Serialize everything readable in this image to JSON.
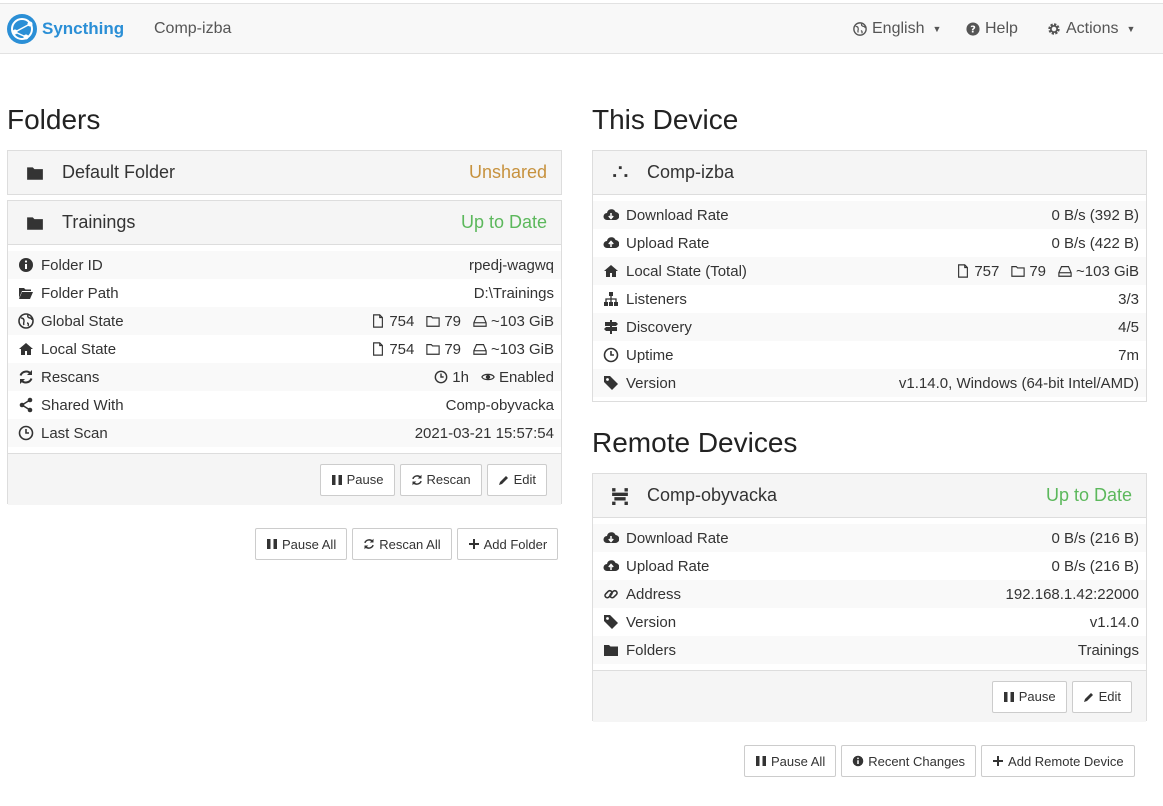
{
  "navbar": {
    "brand": "Syncthing",
    "device_name": "Comp-izba",
    "language": "English",
    "help": "Help",
    "actions": "Actions"
  },
  "folders": {
    "heading": "Folders",
    "default_folder": {
      "name": "Default Folder",
      "status": "Unshared"
    },
    "trainings": {
      "name": "Trainings",
      "status": "Up to Date",
      "rows": [
        {
          "label": "Folder ID",
          "value": "rpedj-wagwq"
        },
        {
          "label": "Folder Path",
          "value": "D:\\Trainings"
        },
        {
          "label": "Global State",
          "files": "754",
          "dirs": "79",
          "size": "~103 GiB"
        },
        {
          "label": "Local State",
          "files": "754",
          "dirs": "79",
          "size": "~103 GiB"
        },
        {
          "label": "Rescans",
          "interval": "1h",
          "watch": "Enabled"
        },
        {
          "label": "Shared With",
          "value": "Comp-obyvacka"
        },
        {
          "label": "Last Scan",
          "value": "2021-03-21 15:57:54"
        }
      ],
      "buttons": {
        "pause": "Pause",
        "rescan": "Rescan",
        "edit": "Edit"
      }
    },
    "buttons": {
      "pause_all": "Pause All",
      "rescan_all": "Rescan All",
      "add_folder": "Add Folder"
    }
  },
  "this_device": {
    "heading": "This Device",
    "name": "Comp-izba",
    "rows": [
      {
        "label": "Download Rate",
        "value": "0 B/s (392 B)"
      },
      {
        "label": "Upload Rate",
        "value": "0 B/s (422 B)"
      },
      {
        "label": "Local State (Total)",
        "files": "757",
        "dirs": "79",
        "size": "~103 GiB"
      },
      {
        "label": "Listeners",
        "value": "3/3"
      },
      {
        "label": "Discovery",
        "value": "4/5"
      },
      {
        "label": "Uptime",
        "value": "7m"
      },
      {
        "label": "Version",
        "value": "v1.14.0, Windows (64-bit Intel/AMD)"
      }
    ]
  },
  "remote_devices": {
    "heading": "Remote Devices",
    "device": {
      "name": "Comp-obyvacka",
      "status": "Up to Date",
      "rows": [
        {
          "label": "Download Rate",
          "value": "0 B/s (216 B)"
        },
        {
          "label": "Upload Rate",
          "value": "0 B/s (216 B)"
        },
        {
          "label": "Address",
          "value": "192.168.1.42:22000"
        },
        {
          "label": "Version",
          "value": "v1.14.0"
        },
        {
          "label": "Folders",
          "value": "Trainings"
        }
      ],
      "buttons": {
        "pause": "Pause",
        "edit": "Edit"
      }
    },
    "buttons": {
      "pause_all": "Pause All",
      "recent_changes": "Recent Changes",
      "add_remote": "Add Remote Device"
    }
  },
  "colors": {
    "accent": "#2b8fd6",
    "ok": "#5cb85c",
    "warn": "#c7923e"
  }
}
